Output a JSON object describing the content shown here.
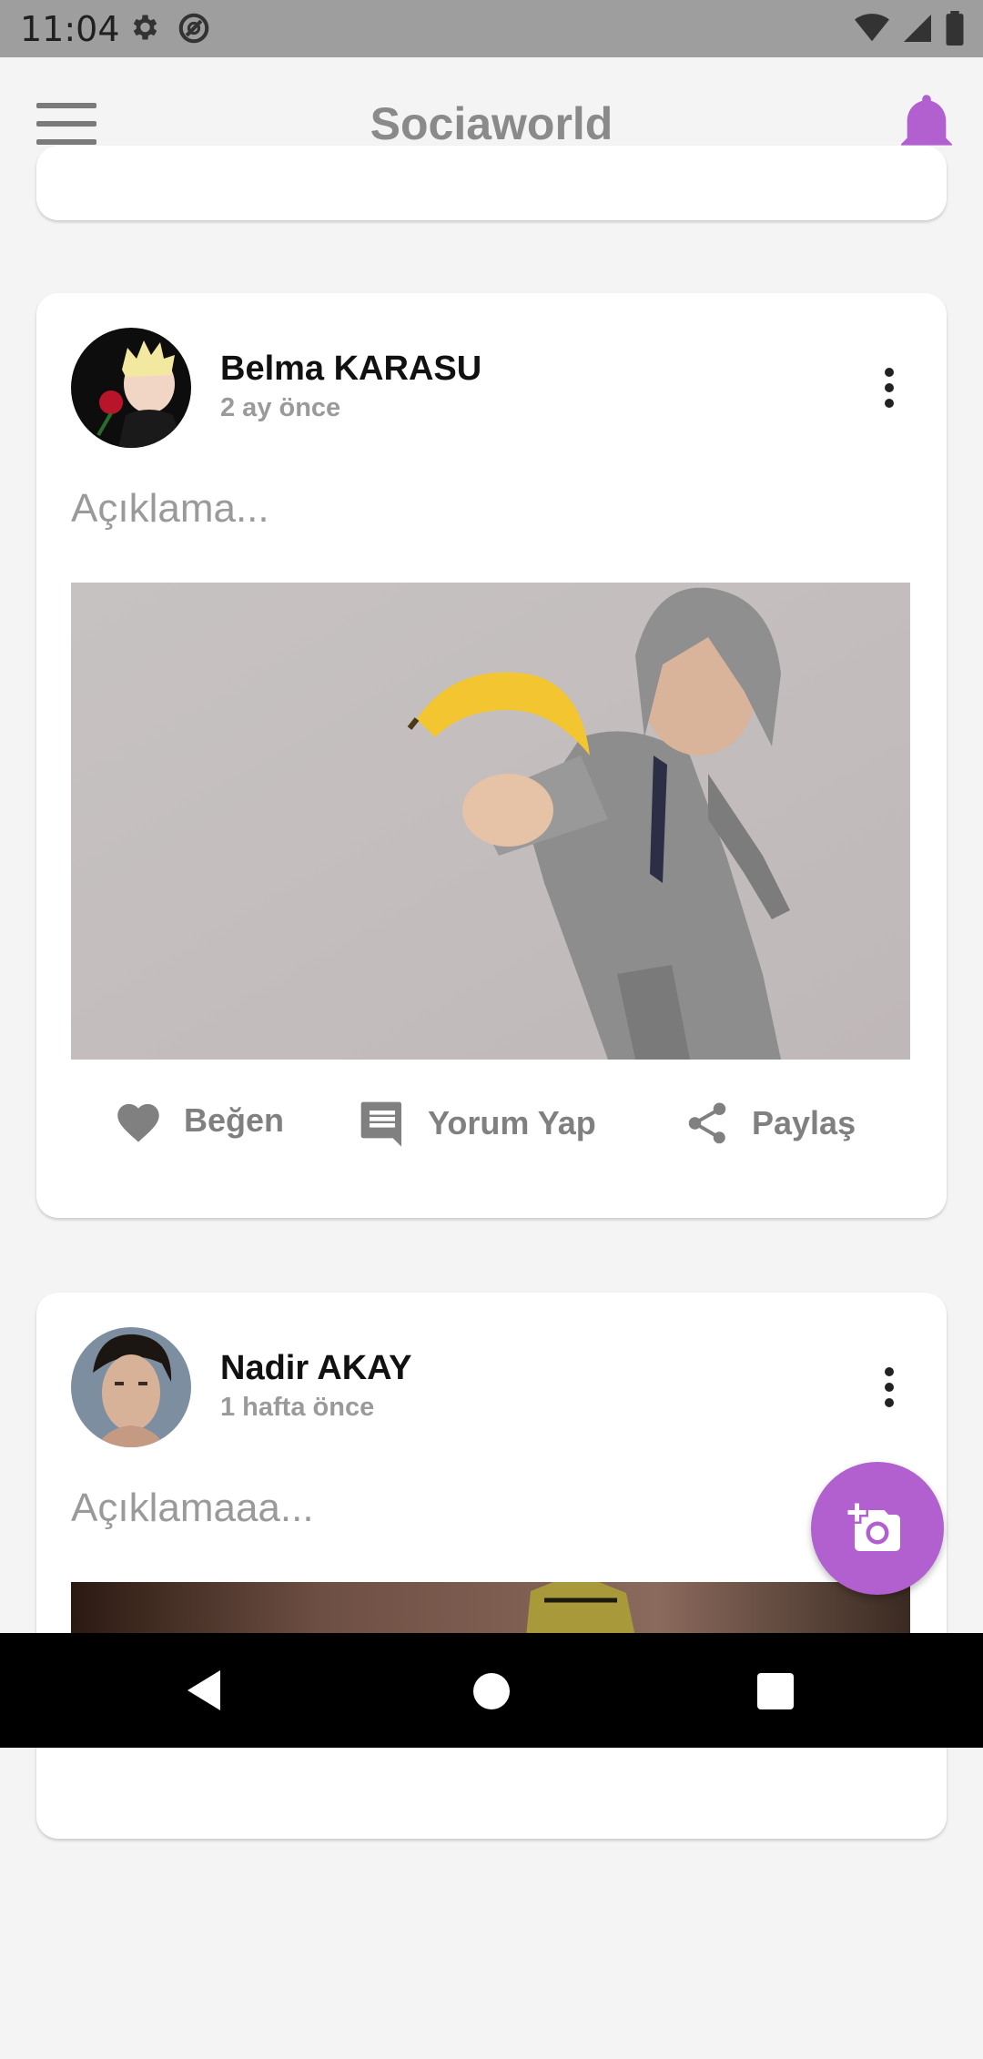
{
  "status_bar": {
    "time": "11:04"
  },
  "app_bar": {
    "title": "Sociaworld",
    "accent_color": "#b25fd0"
  },
  "posts": [
    {
      "author": "Belma KARASU",
      "time": "2 ay önce",
      "description": "Açıklama...",
      "actions": {
        "like": "Beğen",
        "comment": "Yorum Yap",
        "share": "Paylaş"
      }
    },
    {
      "author": "Nadir AKAY",
      "time": "1 hafta önce",
      "description": "Açıklamaaa..."
    }
  ],
  "icons": [
    "menu-icon",
    "bell-icon",
    "more-vert-icon",
    "heart-icon",
    "comment-icon",
    "share-icon",
    "add-photo-icon",
    "back-icon",
    "home-icon",
    "recents-icon"
  ]
}
